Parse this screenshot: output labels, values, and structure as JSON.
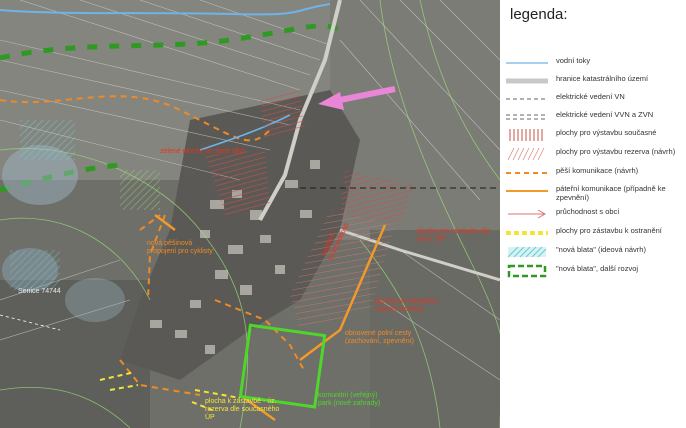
{
  "legend": {
    "title": "legenda:",
    "items": [
      {
        "label": "vodní toky",
        "icon": "water-line-icon"
      },
      {
        "label": "hranice katastrálního území",
        "icon": "cadastral-boundary-icon"
      },
      {
        "label": "elektrické vedení VN",
        "icon": "power-line-vn-icon"
      },
      {
        "label": "elektrické vedení VVN a ZVN",
        "icon": "power-line-vvn-icon"
      },
      {
        "label": "plochy pro výstavbu současné",
        "icon": "hatch-current-icon"
      },
      {
        "label": "plochy pro výstavbu rezerva (návrh)",
        "icon": "hatch-reserve-icon"
      },
      {
        "label": "pěší komunikace (návrh)",
        "icon": "footpath-icon"
      },
      {
        "label": "páteřní komunikace (případně ke zpevnění)",
        "icon": "main-road-icon"
      },
      {
        "label": "průchodnost s obcí",
        "icon": "arrow-icon"
      },
      {
        "label": "plochy pro zástavbu k ostranění",
        "icon": "yellow-hatch-icon"
      },
      {
        "label": "\"nová blata\" (ideová návrh)",
        "icon": "cyan-hatch-icon"
      },
      {
        "label": "\"nová blata\", další rozvoj",
        "icon": "green-dashed-box-icon"
      }
    ]
  },
  "map": {
    "labels": {
      "zelene_plochy": "zelené plochy ve staré obci",
      "nova_pesi": "nová pěšinová propojení pro cyklisty",
      "vystavba_up": "plochy pro výstavbu dle souč. ÚP",
      "zajisteni": "zajištění průchodnosti",
      "vystavba_rezerva": "plochy pro výstavbu - územní rezerva",
      "polni_cesty": "obnovené polní cesty (zachování, zpevnění)",
      "komunitni_park": "komunitní (veřejný) park (nové zahrady)",
      "zastavba_rezerva": "plocha k zástavbě - úz. rezerva dle současného ÚP",
      "town": "Senice 74744"
    },
    "colors": {
      "red_label": "#e8321e",
      "orange_label": "#f08a24",
      "green_label": "#4fd62a",
      "yellow_label": "#f2e43a",
      "magenta_arrow": "#e986d8",
      "cyan_water": "#6fb3e8"
    }
  }
}
